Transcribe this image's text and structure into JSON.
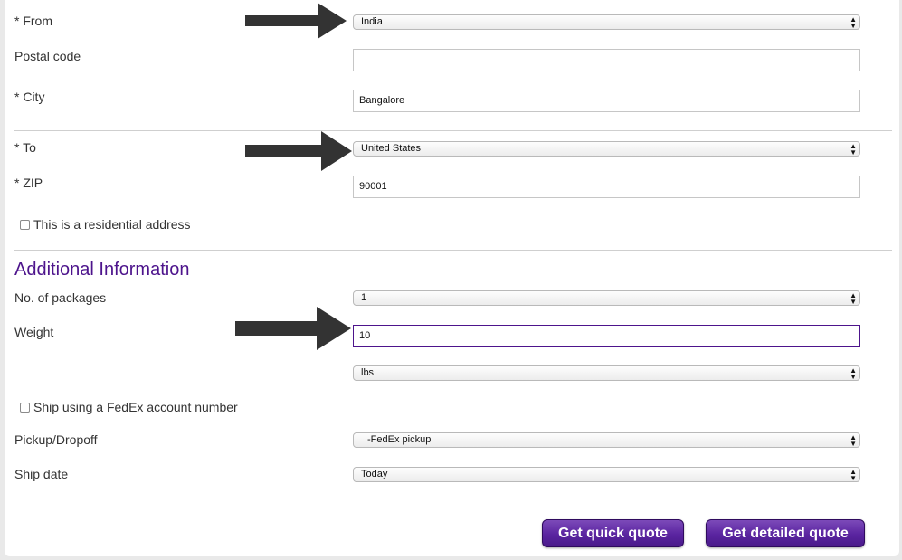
{
  "origin": {
    "from_label": "* From",
    "from_value": "India",
    "postal_label": "Postal code",
    "postal_value": "",
    "city_label": "* City",
    "city_value": "Bangalore"
  },
  "destination": {
    "to_label": "* To",
    "to_value": "United States",
    "zip_label": "* ZIP",
    "zip_value": "90001",
    "residential_label": "This is a residential address",
    "residential_checked": false
  },
  "additional": {
    "heading": "Additional Information",
    "packages_label": "No. of packages",
    "packages_value": "1",
    "weight_label": "Weight",
    "weight_value": "10",
    "unit_value": "lbs",
    "fedex_account_label": "Ship using a FedEx account number",
    "fedex_account_checked": false,
    "pickup_label": "Pickup/Dropoff",
    "pickup_value": "-FedEx pickup",
    "shipdate_label": "Ship date",
    "shipdate_value": "Today"
  },
  "actions": {
    "quick_quote": "Get quick quote",
    "detailed_quote": "Get detailed quote"
  },
  "colors": {
    "accent": "#4d148c",
    "arrow": "#333333"
  },
  "icons": {
    "select_caret": "updown-caret-icon",
    "annotation": "arrow-right-icon"
  }
}
